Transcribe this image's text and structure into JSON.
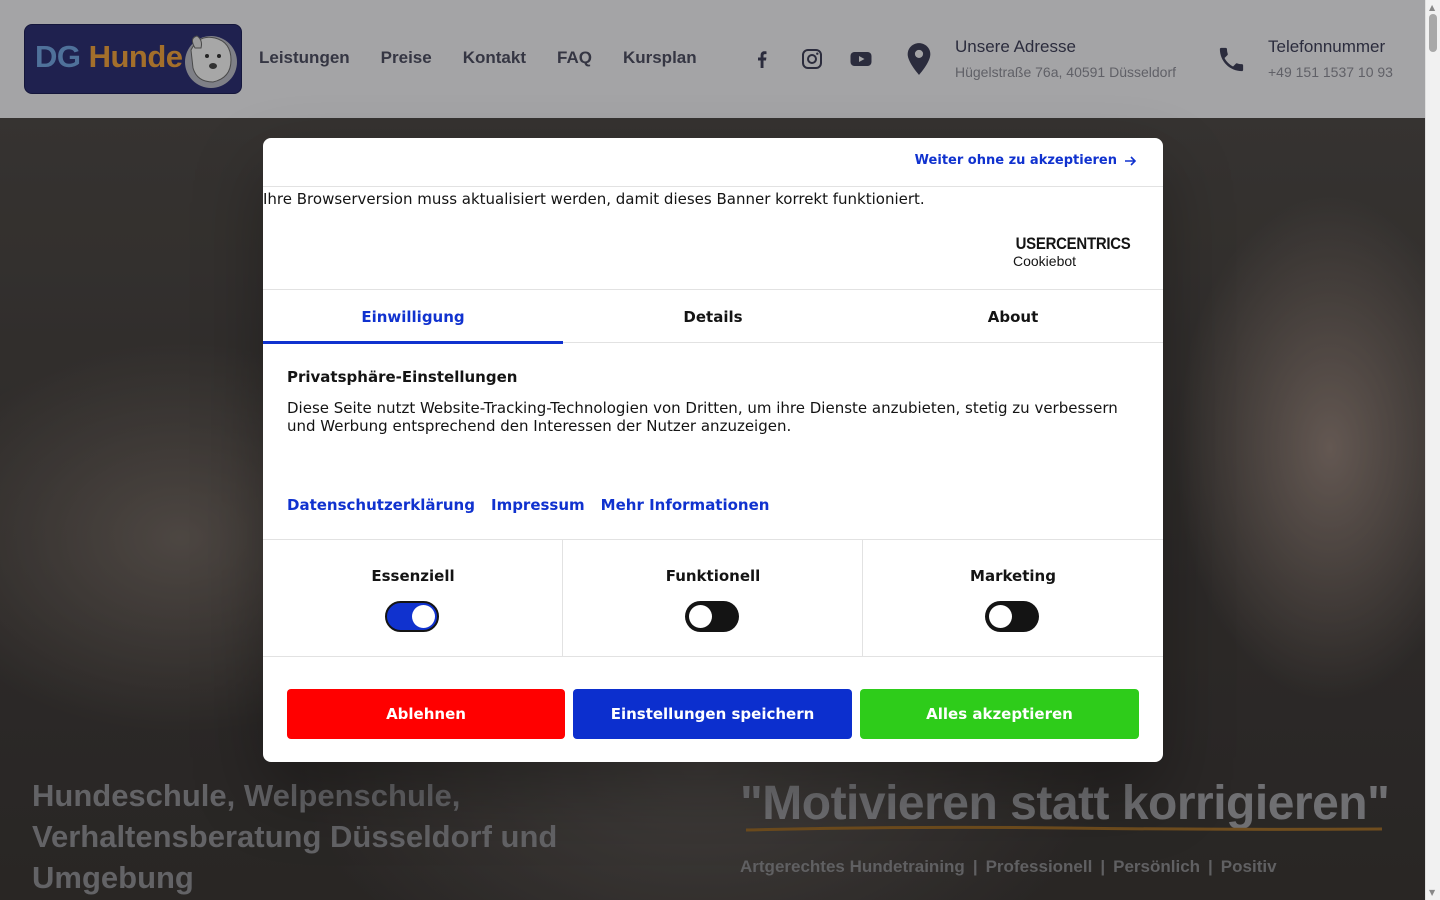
{
  "header": {
    "logo": {
      "dg": "DG",
      "hunde": " Hunde"
    },
    "nav": [
      "Leistungen",
      "Preise",
      "Kontakt",
      "FAQ",
      "Kursplan"
    ],
    "address_title": "Unsere Adresse",
    "address_value": "Hügelstraße 76a, 40591 Düsseldorf",
    "phone_title": "Telefonnummer",
    "phone_value": "+49 151 1537 10 93"
  },
  "hero": {
    "left_text": "Hundeschule, Welpenschule, Verhaltensberatung Düsseldorf und Umgebung",
    "quote": "\"Motivieren statt korrigieren\"",
    "tags": [
      "Artgerechtes Hundetraining",
      "Professionell",
      "Persönlich",
      "Positiv"
    ],
    "tag_separator": "|"
  },
  "dialog": {
    "skip_link": "Weiter ohne zu akzeptieren",
    "browser_note": "Ihre Browserversion muss aktualisiert werden, damit dieses Banner korrekt funktioniert.",
    "brand_top": "USERCENTRICS",
    "brand_bottom": "Cookiebot",
    "tabs": [
      {
        "label": "Einwilligung",
        "active": true
      },
      {
        "label": "Details",
        "active": false
      },
      {
        "label": "About",
        "active": false
      }
    ],
    "section_title": "Privatsphäre-Einstellungen",
    "section_text": "Diese Seite nutzt Website-Tracking-Technologien von Dritten, um ihre Dienste anzubieten, stetig zu verbessern und Werbung entsprechend den Interessen der Nutzer anzuzeigen.",
    "links": [
      "Datenschutzerklärung",
      "Impressum",
      "Mehr Informationen"
    ],
    "consents": [
      {
        "label": "Essenziell",
        "enabled": true
      },
      {
        "label": "Funktionell",
        "enabled": false
      },
      {
        "label": "Marketing",
        "enabled": false
      }
    ],
    "buttons": {
      "deny": "Ablehnen",
      "save": "Einstellungen speichern",
      "accept": "Alles akzeptieren"
    }
  },
  "colors": {
    "accent": "#1032cf",
    "deny": "#ff0000",
    "save": "#0c2fce",
    "accept": "#2ecc1a"
  },
  "icons": {
    "social": [
      "facebook-icon",
      "instagram-icon",
      "youtube-icon"
    ],
    "address": "location-pin-icon",
    "phone": "phone-icon",
    "skip": "arrow-right-icon",
    "brand": "shield-icon"
  }
}
